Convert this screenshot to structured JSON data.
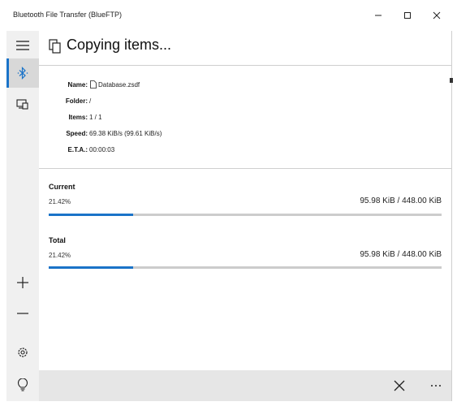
{
  "window": {
    "title": "Bluetooth File Transfer (BlueFTP)"
  },
  "sidebar": {
    "items": [
      {
        "icon": "hamburger-icon"
      },
      {
        "icon": "bluetooth-icon",
        "selected": true
      },
      {
        "icon": "devices-icon"
      },
      {
        "icon": "add-icon"
      },
      {
        "icon": "remove-icon"
      },
      {
        "icon": "settings-icon"
      },
      {
        "icon": "lightbulb-icon"
      }
    ]
  },
  "header": {
    "title": "Copying items..."
  },
  "info": {
    "name_label": "Name:",
    "name_value": "Database.zsdf",
    "folder_label": "Folder:",
    "folder_value": "/",
    "items_label": "Items:",
    "items_value": "1 / 1",
    "speed_label": "Speed:",
    "speed_value": "69.38 KiB/s (99.61 KiB/s)",
    "eta_label": "E.T.A.:",
    "eta_value": "00:00:03"
  },
  "progress": {
    "current": {
      "title": "Current",
      "percent_text": "21.42%",
      "fraction": 0.2142,
      "size_text": "95.98 KiB / 448.00 KiB"
    },
    "total": {
      "title": "Total",
      "percent_text": "21.42%",
      "fraction": 0.2142,
      "size_text": "95.98 KiB / 448.00 KiB"
    }
  },
  "colors": {
    "accent": "#1a73c8",
    "track": "#cccccc",
    "sidebar": "#f0f0f0",
    "commandbar": "#e6e6e6"
  }
}
